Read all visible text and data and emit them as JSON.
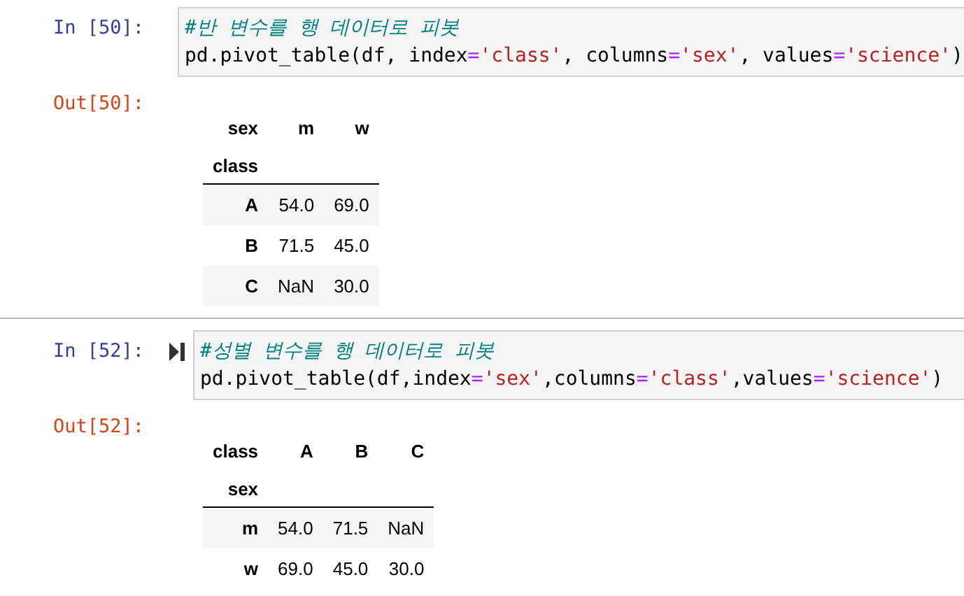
{
  "cells": [
    {
      "in_prompt": "In [50]:",
      "comment": "#반 변수를 행 데이터로 피봇",
      "code": [
        {
          "kind": "plain",
          "text": "pd.pivot_table(df, index"
        },
        {
          "kind": "op",
          "text": "="
        },
        {
          "kind": "str",
          "text": "'class'"
        },
        {
          "kind": "plain",
          "text": ", columns"
        },
        {
          "kind": "op",
          "text": "="
        },
        {
          "kind": "str",
          "text": "'sex'"
        },
        {
          "kind": "plain",
          "text": ", values"
        },
        {
          "kind": "op",
          "text": "="
        },
        {
          "kind": "str",
          "text": "'science'"
        },
        {
          "kind": "plain",
          "text": ")"
        }
      ],
      "out_prompt": "Out[50]:",
      "table": {
        "columns_name": "sex",
        "columns": [
          "m",
          "w"
        ],
        "index_name": "class",
        "rows": [
          {
            "index": "A",
            "values": [
              "54.0",
              "69.0"
            ]
          },
          {
            "index": "B",
            "values": [
              "71.5",
              "45.0"
            ]
          },
          {
            "index": "C",
            "values": [
              "NaN",
              "30.0"
            ]
          }
        ]
      }
    },
    {
      "in_prompt": "In [52]:",
      "comment": "#성별 변수를 행 데이터로 피봇",
      "code": [
        {
          "kind": "plain",
          "text": "pd.pivot_table(df,index"
        },
        {
          "kind": "op",
          "text": "="
        },
        {
          "kind": "str",
          "text": "'sex'"
        },
        {
          "kind": "plain",
          "text": ",columns"
        },
        {
          "kind": "op",
          "text": "="
        },
        {
          "kind": "str",
          "text": "'class'"
        },
        {
          "kind": "plain",
          "text": ",values"
        },
        {
          "kind": "op",
          "text": "="
        },
        {
          "kind": "str",
          "text": "'science'"
        },
        {
          "kind": "plain",
          "text": ")"
        }
      ],
      "out_prompt": "Out[52]:",
      "table": {
        "columns_name": "class",
        "columns": [
          "A",
          "B",
          "C"
        ],
        "index_name": "sex",
        "rows": [
          {
            "index": "m",
            "values": [
              "54.0",
              "71.5",
              "NaN"
            ]
          },
          {
            "index": "w",
            "values": [
              "69.0",
              "45.0",
              "30.0"
            ]
          }
        ]
      }
    }
  ]
}
